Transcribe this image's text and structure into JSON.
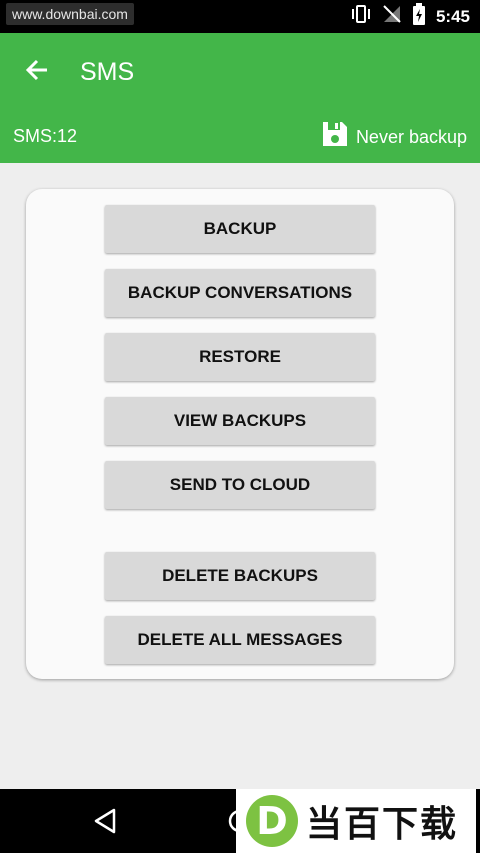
{
  "status_bar": {
    "watermark": "www.downbai.com",
    "time": "5:45"
  },
  "app_bar": {
    "title": "SMS",
    "sms_count": "SMS:12",
    "backup_status": "Never backup"
  },
  "actions": [
    {
      "label": "BACKUP"
    },
    {
      "label": "BACKUP CONVERSATIONS"
    },
    {
      "label": "RESTORE"
    },
    {
      "label": "VIEW BACKUPS"
    },
    {
      "label": "SEND TO CLOUD"
    },
    {
      "label": "DELETE BACKUPS"
    },
    {
      "label": "DELETE ALL MESSAGES"
    }
  ],
  "watermark": {
    "logo_letter": "D",
    "text": "当百下载"
  },
  "colors": {
    "primary": "#43b649",
    "background": "#eeeeee",
    "button": "#d9d9d9"
  }
}
